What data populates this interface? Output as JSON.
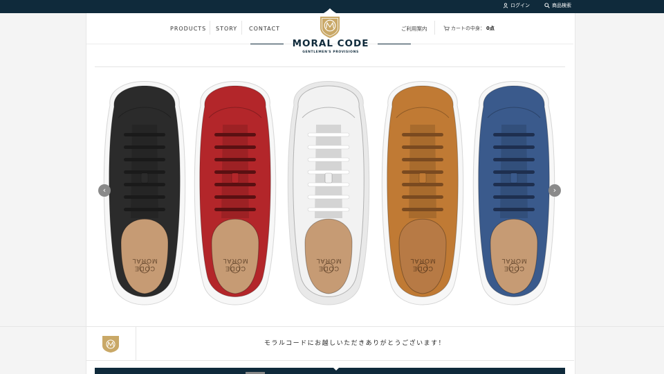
{
  "topbar": {
    "login_label": "ログイン",
    "search_label": "商品検索"
  },
  "nav": {
    "products": "PRODUCTS",
    "story": "STORY",
    "contact": "CONTACT"
  },
  "header": {
    "guide_label": "ご利用案内",
    "cart_label": "カートの中身：",
    "cart_count": "0点",
    "brand_name": "MORAL CODE",
    "tagline": "GENTLEMEN'S PROVISIONS"
  },
  "colors": {
    "navy": "#0f2a3b",
    "gold": "#c9a867",
    "shoes": [
      "#2b2b2b",
      "#b3262a",
      "#f2f2f2",
      "#c07a34",
      "#3a5a8c"
    ]
  },
  "insole_text": {
    "line1": "CODE",
    "line2": "MORAL"
  },
  "welcome_text": "モラルコードにお越しいただきありがとうございます！",
  "icons": [
    "user-icon",
    "search-icon",
    "cart-icon",
    "arrow-left-icon",
    "arrow-right-icon",
    "brand-badge-icon"
  ]
}
